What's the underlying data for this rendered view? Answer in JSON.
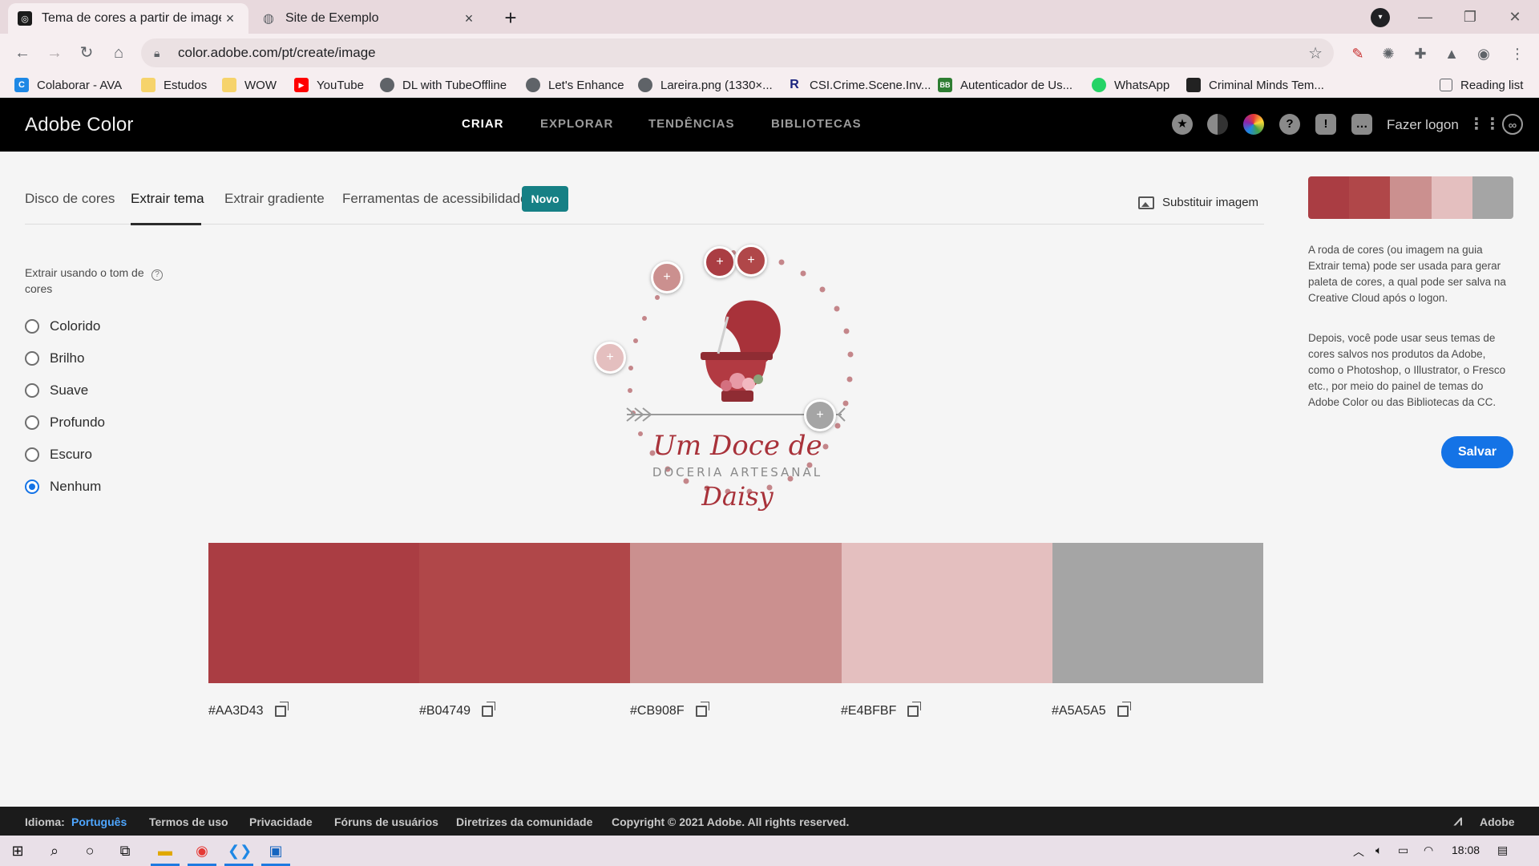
{
  "browser": {
    "tabs": [
      {
        "title": "Tema de cores a partir de imagem",
        "close": "×",
        "active": true
      },
      {
        "title": "Site de Exemplo",
        "close": "×",
        "active": false
      }
    ],
    "new_tab": "+",
    "url": "color.adobe.com/pt/create/image",
    "bookmarks": [
      {
        "label": "Colaborar - AVA",
        "icon": "ava-icon",
        "color": "#1e88e5"
      },
      {
        "label": "Estudos",
        "icon": "folder-icon",
        "color": "#f6d36b"
      },
      {
        "label": "WOW",
        "icon": "folder-icon",
        "color": "#f6d36b"
      },
      {
        "label": "YouTube",
        "icon": "youtube-icon",
        "color": "#ff0000"
      },
      {
        "label": "DL with TubeOffline",
        "icon": "globe-icon",
        "color": "#5f6368"
      },
      {
        "label": "Let's Enhance",
        "icon": "globe-icon",
        "color": "#5f6368"
      },
      {
        "label": "Lareira.png (1330×...",
        "icon": "globe-icon",
        "color": "#5f6368"
      },
      {
        "label": "CSI.Crime.Scene.Inv...",
        "icon": "r-icon",
        "color": "#1a237e"
      },
      {
        "label": "Autenticador de Us...",
        "icon": "bb-icon",
        "color": "#2e7d32"
      },
      {
        "label": "WhatsApp",
        "icon": "whatsapp-icon",
        "color": "#25d366"
      },
      {
        "label": "Criminal Minds Tem...",
        "icon": "film-icon",
        "color": "#222222"
      }
    ],
    "reading_list": "Reading list"
  },
  "header": {
    "brand": "Adobe Color",
    "nav": [
      "CRIAR",
      "EXPLORAR",
      "TENDÊNCIAS",
      "BIBLIOTECAS"
    ],
    "active_nav": "CRIAR",
    "login": "Fazer logon"
  },
  "subtabs": {
    "items": [
      "Disco de cores",
      "Extrair tema",
      "Extrair gradiente",
      "Ferramentas de acessibilidade"
    ],
    "active": "Extrair tema",
    "badge": "Novo",
    "replace_image": "Substituir imagem"
  },
  "mood": {
    "label": "Extrair usando o tom de cores",
    "help": "?",
    "options": [
      "Colorido",
      "Brilho",
      "Suave",
      "Profundo",
      "Escuro",
      "Nenhum"
    ],
    "selected": "Nenhum"
  },
  "logo": {
    "line1": "Um Doce de",
    "line2": "DOCERIA ARTESANAL",
    "line3": "Daisy"
  },
  "palette": [
    {
      "hex": "#AA3D43",
      "color": "#AA3D43"
    },
    {
      "hex": "#B04749",
      "color": "#B04749"
    },
    {
      "hex": "#CB908F",
      "color": "#CB908F"
    },
    {
      "hex": "#E4BFBF",
      "color": "#E4BFBF"
    },
    {
      "hex": "#A5A5A5",
      "color": "#A5A5A5"
    }
  ],
  "right_panel": {
    "info1": "A roda de cores (ou imagem na guia Extrair tema) pode ser usada para gerar paleta de cores, a qual pode ser salva na Creative Cloud após o logon.",
    "info2": "Depois, você pode usar seus temas de cores salvos nos produtos da Adobe, como o Photoshop, o Illustrator, o Fresco etc., por meio do painel de temas do Adobe Color ou das Bibliotecas da CC.",
    "save": "Salvar"
  },
  "footer": {
    "lang_label": "Idioma:",
    "lang": "Português",
    "links": [
      "Termos de uso",
      "Privacidade",
      "Fóruns de usuários",
      "Diretrizes da comunidade"
    ],
    "copyright": "Copyright © 2021 Adobe. All rights reserved.",
    "adobe": "Adobe"
  },
  "taskbar": {
    "time": "18:08"
  }
}
